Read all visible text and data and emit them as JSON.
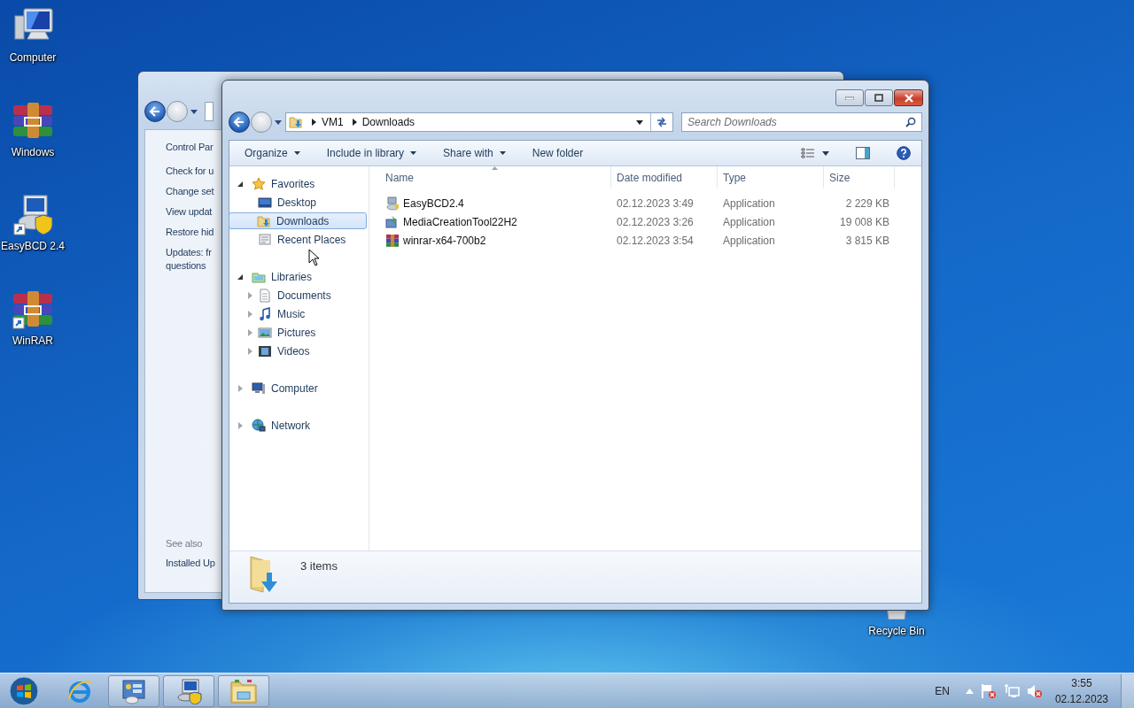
{
  "desktop_icons": [
    {
      "label": "Computer",
      "kind": "computer"
    },
    {
      "label": "Windows",
      "kind": "archive"
    },
    {
      "label": "EasyBCD 2.4",
      "kind": "easybcd"
    },
    {
      "label": "WinRAR",
      "kind": "archive_shortcut"
    }
  ],
  "recycle_bin": {
    "label": "Recycle Bin"
  },
  "back_window": {
    "heading": "Control Par",
    "links": [
      [
        "Check for u"
      ],
      [
        "Change set"
      ],
      [
        "View updat"
      ],
      [
        "Restore hid"
      ],
      [
        "Updates: fr",
        "questions"
      ]
    ],
    "see_also": "See also",
    "see_also_link": "Installed Up"
  },
  "explorer": {
    "breadcrumb": [
      "VM1",
      "Downloads"
    ],
    "search": {
      "placeholder": "Search Downloads"
    },
    "toolbar": [
      {
        "label": "Organize",
        "has_menu": true
      },
      {
        "label": "Include in library",
        "has_menu": true
      },
      {
        "label": "Share with",
        "has_menu": true
      },
      {
        "label": "New folder",
        "has_menu": false
      }
    ],
    "nav": [
      {
        "label": "Favorites",
        "kind": "favorites",
        "expanded": true,
        "selected": false,
        "children": [
          {
            "label": "Desktop",
            "kind": "desktop",
            "selected": false
          },
          {
            "label": "Downloads",
            "kind": "downloads",
            "selected": true
          },
          {
            "label": "Recent Places",
            "kind": "recent",
            "selected": false
          }
        ]
      },
      {
        "label": "Libraries",
        "kind": "libraries",
        "expanded": true,
        "selected": false,
        "children": [
          {
            "label": "Documents",
            "kind": "documents",
            "expanded": false,
            "selected": false
          },
          {
            "label": "Music",
            "kind": "music",
            "expanded": false,
            "selected": false
          },
          {
            "label": "Pictures",
            "kind": "pictures",
            "expanded": false,
            "selected": false
          },
          {
            "label": "Videos",
            "kind": "videos",
            "expanded": false,
            "selected": false
          }
        ]
      },
      {
        "label": "Computer",
        "kind": "computer",
        "expanded": false,
        "selected": false
      },
      {
        "label": "Network",
        "kind": "network",
        "expanded": false,
        "selected": false
      }
    ],
    "columns": [
      {
        "label": "Name",
        "sorted": true
      },
      {
        "label": "Date modified",
        "sorted": false
      },
      {
        "label": "Type",
        "sorted": false
      },
      {
        "label": "Size",
        "sorted": false
      }
    ],
    "files": [
      {
        "name": "EasyBCD2.4",
        "kind": "easybcd",
        "date": "02.12.2023 3:49",
        "type": "Application",
        "size": "2 229 KB"
      },
      {
        "name": "MediaCreationTool22H2",
        "kind": "media",
        "date": "02.12.2023 3:26",
        "type": "Application",
        "size": "19 008 KB"
      },
      {
        "name": "winrar-x64-700b2",
        "kind": "winrar",
        "date": "02.12.2023 3:54",
        "type": "Application",
        "size": "3 815 KB"
      }
    ],
    "status": "3 items"
  },
  "taskbar": {
    "language": "EN",
    "time": "3:55",
    "date": "02.12.2023"
  }
}
